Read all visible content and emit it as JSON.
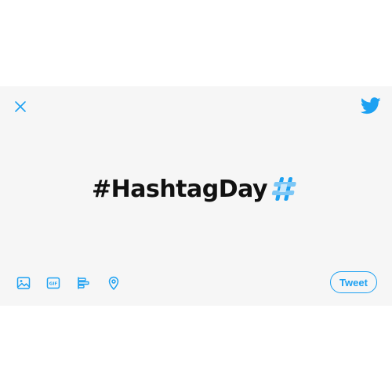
{
  "composer": {
    "headline": "#HashtagDay",
    "tweet_button_label": "Tweet"
  },
  "icons": {
    "close": "close-icon",
    "brand": "twitter-bird-icon",
    "hashflag": "hashtag-emoji-icon",
    "media": "image-icon",
    "gif": "gif-icon",
    "poll": "poll-icon",
    "location": "location-pin-icon"
  },
  "colors": {
    "accent": "#1da1f2",
    "card_background": "#f6f6f6",
    "text": "#111111"
  }
}
